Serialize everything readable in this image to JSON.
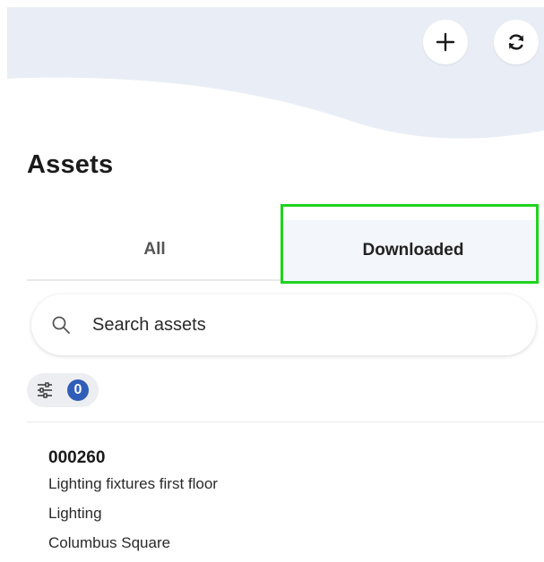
{
  "header": {
    "add_icon": "plus-icon",
    "refresh_icon": "refresh-icon",
    "wave_color": "#e9eef6"
  },
  "page": {
    "title": "Assets"
  },
  "tabs": [
    {
      "label": "All",
      "selected": false
    },
    {
      "label": "Downloaded",
      "selected": true
    }
  ],
  "highlight_color": "#1fd31f",
  "search": {
    "icon": "search-icon",
    "placeholder": "Search assets",
    "value": ""
  },
  "filter": {
    "icon": "sliders-icon",
    "count": "0",
    "badge_color": "#2f5db8"
  },
  "assets": [
    {
      "id": "000260",
      "description": "Lighting fixtures first floor",
      "category": "Lighting",
      "location": "Columbus Square"
    }
  ]
}
